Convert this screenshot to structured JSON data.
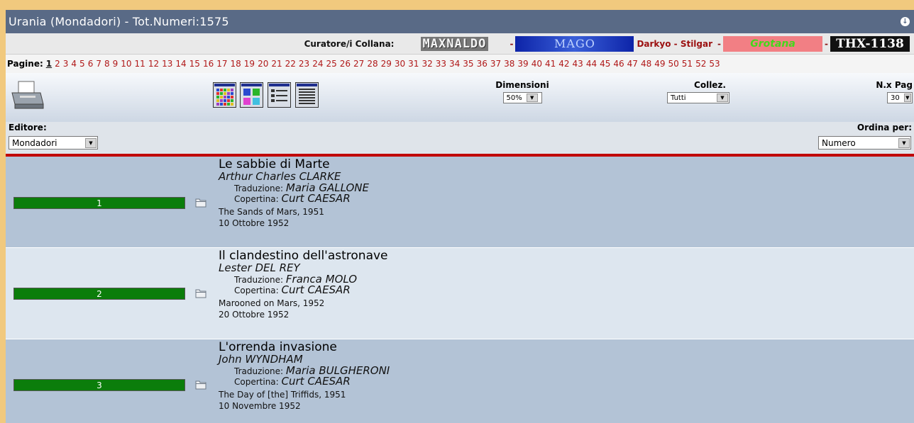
{
  "window": {
    "title": "Urania (Mondadori) - Tot.Numeri:1575"
  },
  "curators": {
    "label": "Curatore/i Collana:",
    "logos": {
      "maxnaldo": "MAXNALDO",
      "mago": "MAGO",
      "grotana": "Grotana",
      "thx": "THX-1138"
    },
    "dash": "-",
    "mid_text": "Darkyo - Stilgar"
  },
  "pagination": {
    "label": "Pagine:",
    "pages": [
      "1",
      "2",
      "3",
      "4",
      "5",
      "6",
      "7",
      "8",
      "9",
      "10",
      "11",
      "12",
      "13",
      "14",
      "15",
      "16",
      "17",
      "18",
      "19",
      "20",
      "21",
      "22",
      "23",
      "24",
      "25",
      "26",
      "27",
      "28",
      "29",
      "30",
      "31",
      "32",
      "33",
      "34",
      "35",
      "36",
      "37",
      "38",
      "39",
      "40",
      "41",
      "42",
      "43",
      "44",
      "45",
      "46",
      "47",
      "48",
      "49",
      "50",
      "51",
      "52",
      "53"
    ],
    "current": "1"
  },
  "toolbar": {
    "dimensioni": {
      "label": "Dimensioni",
      "value": "50%"
    },
    "collez": {
      "label": "Collez.",
      "value": "Tutti"
    },
    "nxpag": {
      "label": "N.x Pag",
      "value": "30"
    }
  },
  "filters": {
    "editore": {
      "label": "Editore:",
      "value": "Mondadori"
    },
    "ordina": {
      "label": "Ordina per:",
      "value": "Numero"
    }
  },
  "items": [
    {
      "number": "1",
      "title": "Le sabbie di Marte",
      "author": "Arthur Charles CLARKE",
      "trad_label": "Traduzione:",
      "translator": "Maria GALLONE",
      "cover_label": "Copertina:",
      "cover_artist": "Curt CAESAR",
      "original": "The Sands of Mars, 1951",
      "date": "10 Ottobre 1952"
    },
    {
      "number": "2",
      "title": "Il clandestino dell'astronave",
      "author": "Lester DEL REY",
      "trad_label": "Traduzione:",
      "translator": "Franca MOLO",
      "cover_label": "Copertina:",
      "cover_artist": "Curt CAESAR",
      "original": "Marooned on Mars, 1952",
      "date": "20 Ottobre 1952"
    },
    {
      "number": "3",
      "title": "L'orrenda invasione",
      "author": "John WYNDHAM",
      "trad_label": "Traduzione:",
      "translator": "Maria BULGHERONI",
      "cover_label": "Copertina:",
      "cover_artist": "Curt CAESAR",
      "original": "The Day of [the] Triffids, 1951",
      "date": "10 Novembre 1952"
    }
  ],
  "colors": {
    "titlebar": "#596a86",
    "progress": "#0b7d0b",
    "accent_red": "#c00000",
    "row_dark": "#b3c3d6",
    "row_light": "#dde6ef"
  },
  "icons": {
    "printer": "printer-icon",
    "folder": "folder-icon",
    "download": "download-icon",
    "dropdown": "chevron-down-icon"
  }
}
